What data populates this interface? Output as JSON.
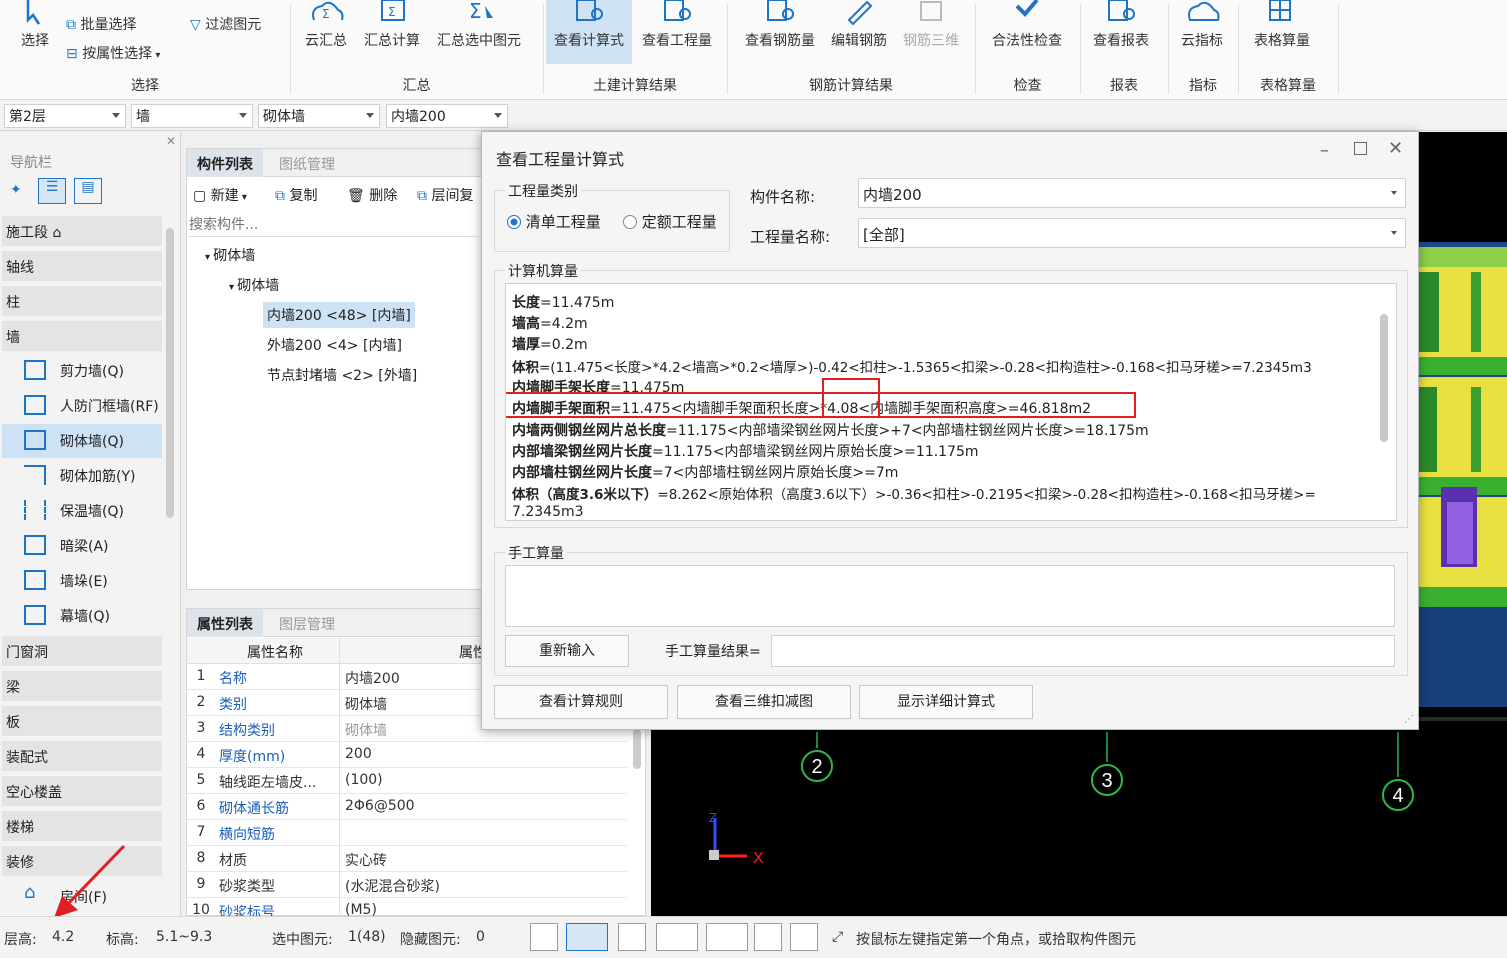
{
  "ribbon": {
    "buttons": [
      {
        "label": "选择"
      },
      {
        "label": "云汇总"
      },
      {
        "label": "汇总计算"
      },
      {
        "label": "汇总选中图元"
      },
      {
        "label": "查看计算式"
      },
      {
        "label": "查看工程量"
      },
      {
        "label": "查看钢筋量"
      },
      {
        "label": "编辑钢筋"
      },
      {
        "label": "钢筋三维"
      },
      {
        "label": "合法性检查"
      },
      {
        "label": "查看报表"
      },
      {
        "label": "云指标"
      },
      {
        "label": "表格算量"
      }
    ],
    "small": {
      "batch_select": "批量选择",
      "by_property": "按属性选择",
      "filter": "过滤图元"
    },
    "groups": [
      "选择",
      "汇总",
      "土建计算结果",
      "钢筋计算结果",
      "检查",
      "报表",
      "指标",
      "表格算量"
    ]
  },
  "toolbar2": {
    "floor": "第2层",
    "type": "墙",
    "subtype": "砌体墙",
    "component": "内墙200"
  },
  "nav": {
    "title": "导航栏",
    "categories": [
      "施工段",
      "轴线",
      "柱",
      "墙",
      "门窗洞",
      "梁",
      "板",
      "装配式",
      "空心楼盖",
      "楼梯",
      "装修"
    ],
    "wall_items": [
      "剪力墙(Q)",
      "人防门框墙(RF)",
      "砌体墙(Q)",
      "砌体加筋(Y)",
      "保温墙(Q)",
      "暗梁(A)",
      "墙垛(E)",
      "幕墙(Q)"
    ],
    "room_item": "房间(F)"
  },
  "complist": {
    "tab_active": "构件列表",
    "tab_inactive": "图纸管理",
    "tools": {
      "new": "新建",
      "copy": "复制",
      "delete": "删除",
      "layer_copy": "层间复"
    },
    "search_placeholder": "搜索构件...",
    "tree": {
      "root": "砌体墙",
      "child": "砌体墙",
      "items": [
        "内墙200 <48> [内墙]",
        "外墙200 <4> [内墙]",
        "节点封堵墙 <2> [外墙]"
      ]
    }
  },
  "proplist": {
    "tab_active": "属性列表",
    "tab_inactive": "图层管理",
    "col_name": "属性名称",
    "col_value": "属性",
    "rows": [
      {
        "n": "1",
        "name": "名称",
        "value": "内墙200"
      },
      {
        "n": "2",
        "name": "类别",
        "value": "砌体墙"
      },
      {
        "n": "3",
        "name": "结构类别",
        "value": "砌体墙"
      },
      {
        "n": "4",
        "name": "厚度(mm)",
        "value": "200"
      },
      {
        "n": "5",
        "name": "轴线距左墙皮...",
        "value": "(100)"
      },
      {
        "n": "6",
        "name": "砌体通长筋",
        "value": "2Φ6@500"
      },
      {
        "n": "7",
        "name": "横向短筋",
        "value": ""
      },
      {
        "n": "8",
        "name": "材质",
        "value": "实心砖"
      },
      {
        "n": "9",
        "name": "砂浆类型",
        "value": "(水泥混合砂浆)"
      },
      {
        "n": "10",
        "name": "砂浆标号",
        "value": "(M5)"
      }
    ]
  },
  "dialog": {
    "title": "查看工程量计算式",
    "category_legend": "工程量类别",
    "radio_bill": "清单工程量",
    "radio_quota": "定额工程量",
    "comp_name_label": "构件名称:",
    "comp_name_value": "内墙200",
    "qty_name_label": "工程量名称:",
    "qty_name_value": "[全部]",
    "computer_legend": "计算机算量",
    "formulas": [
      {
        "k": "长度",
        "v": "=11.475m"
      },
      {
        "k": "墙高",
        "v": "=4.2m"
      },
      {
        "k": "墙厚",
        "v": "=0.2m"
      },
      {
        "k": "体积",
        "v": "=(11.475<长度>*4.2<墙高>*0.2<墙厚>)-0.42<扣柱>-1.5365<扣梁>-0.28<扣构造柱>-0.168<扣马牙槎>=7.2345m3"
      },
      {
        "k": "内墙脚手架长度",
        "v": "=11.475m"
      },
      {
        "k": "内墙脚手架面积",
        "v": "=11.475<内墙脚手架面积长度>*4.08<内墙脚手架面积高度>=46.818m2"
      },
      {
        "k": "内墙两侧钢丝网片总长度",
        "v": "=11.175<内部墙梁钢丝网片长度>+7<内部墙柱钢丝网片长度>=18.175m"
      },
      {
        "k": "内部墙梁钢丝网片长度",
        "v": "=11.175<内部墙梁钢丝网片原始长度>=11.175m"
      },
      {
        "k": "内部墙柱钢丝网片长度",
        "v": "=7<内部墙柱钢丝网片原始长度>=7m"
      },
      {
        "k": "体积（高度3.6米以下）",
        "v": "=8.262<原始体积（高度3.6以下）>-0.36<扣柱>-0.2195<扣梁>-0.28<扣构造柱>-0.168<扣马牙槎>="
      },
      {
        "k": "",
        "v": "7.2345m3"
      }
    ],
    "manual_legend": "手工算量",
    "reenter": "重新输入",
    "manual_result_label": "手工算量结果=",
    "btn_rules": "查看计算规则",
    "btn_3d": "查看三维扣减图",
    "btn_detail": "显示详细计算式"
  },
  "viewport": {
    "axes": [
      "2",
      "3",
      "4"
    ],
    "axis_z": "Z",
    "axis_x": "X"
  },
  "status": {
    "floor_height_label": "层高:",
    "floor_height": "4.2",
    "elev_label": "标高:",
    "elev": "5.1~9.3",
    "selected_label": "选中图元:",
    "selected": "1(48)",
    "hidden_label": "隐藏图元:",
    "hidden": "0",
    "hint": "按鼠标左键指定第一个角点，或拾取构件图元"
  },
  "colors": {
    "highlight_red": "#e02020",
    "link_blue": "#1b5fbd",
    "selected_bg": "#cde2f5"
  }
}
